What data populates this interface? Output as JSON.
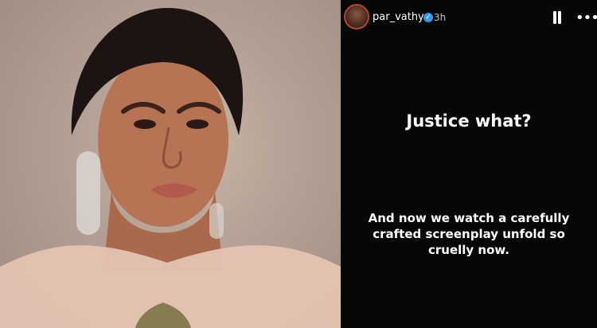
{
  "story": {
    "username": "par_vathy",
    "time": "3h",
    "headline": "Justice what?",
    "body": "And now we watch a carefully crafted screenplay unfold so cruelly now."
  },
  "icons": {
    "verified": "verified-badge-icon",
    "pause": "pause-icon",
    "more": "more-horizontal-icon"
  },
  "colors": {
    "story_background": "#070707",
    "verified_blue": "#3897f0"
  }
}
